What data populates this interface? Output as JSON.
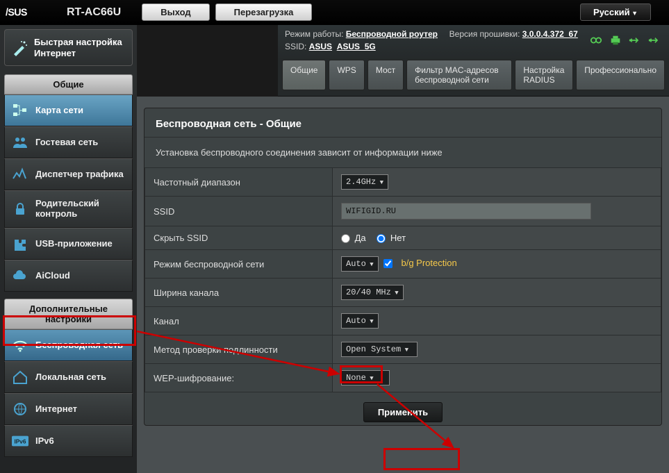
{
  "header": {
    "model": "RT-AC66U",
    "logout": "Выход",
    "reboot": "Перезагрузка",
    "language": "Русский"
  },
  "infobar": {
    "mode_label": "Режим работы:",
    "mode_value": "Беспроводной роутер",
    "fw_label": "Версия прошивки:",
    "fw_value": "3.0.0.4.372_67",
    "ssid_label": "SSID:",
    "ssid1": "ASUS",
    "ssid2": "ASUS_5G"
  },
  "tabs": [
    "Общие",
    "WPS",
    "Мост",
    "Фильтр MAC-адресов беспроводной сети",
    "Настройка RADIUS",
    "Профессионально"
  ],
  "sidebar": {
    "quick": "Быстрая настройка Интернет",
    "sec_general": "Общие",
    "general_items": [
      "Карта сети",
      "Гостевая сеть",
      "Диспетчер трафика",
      "Родительский контроль",
      "USB-приложение",
      "AiCloud"
    ],
    "sec_adv": "Дополнительные настройки",
    "adv_items": [
      "Беспроводная сеть",
      "Локальная сеть",
      "Интернет",
      "IPv6"
    ]
  },
  "panel": {
    "title": "Беспроводная сеть - Общие",
    "subtitle": "Установка беспроводного соединения зависит от информации ниже",
    "rows": {
      "band_label": "Частотный диапазон",
      "band_value": "2.4GHz",
      "ssid_label": "SSID",
      "ssid_value": "WIFIGID.RU",
      "hide_label": "Скрыть SSID",
      "hide_yes": "Да",
      "hide_no": "Нет",
      "mode_label": "Режим беспроводной сети",
      "mode_value": "Auto",
      "bg_protection": "b/g Protection",
      "width_label": "Ширина канала",
      "width_value": "20/40 MHz",
      "channel_label": "Канал",
      "channel_value": "Auto",
      "auth_label": "Метод проверки подлинности",
      "auth_value": "Open System",
      "wep_label": "WEP-шифрование:",
      "wep_value": "None"
    },
    "apply": "Применить"
  }
}
